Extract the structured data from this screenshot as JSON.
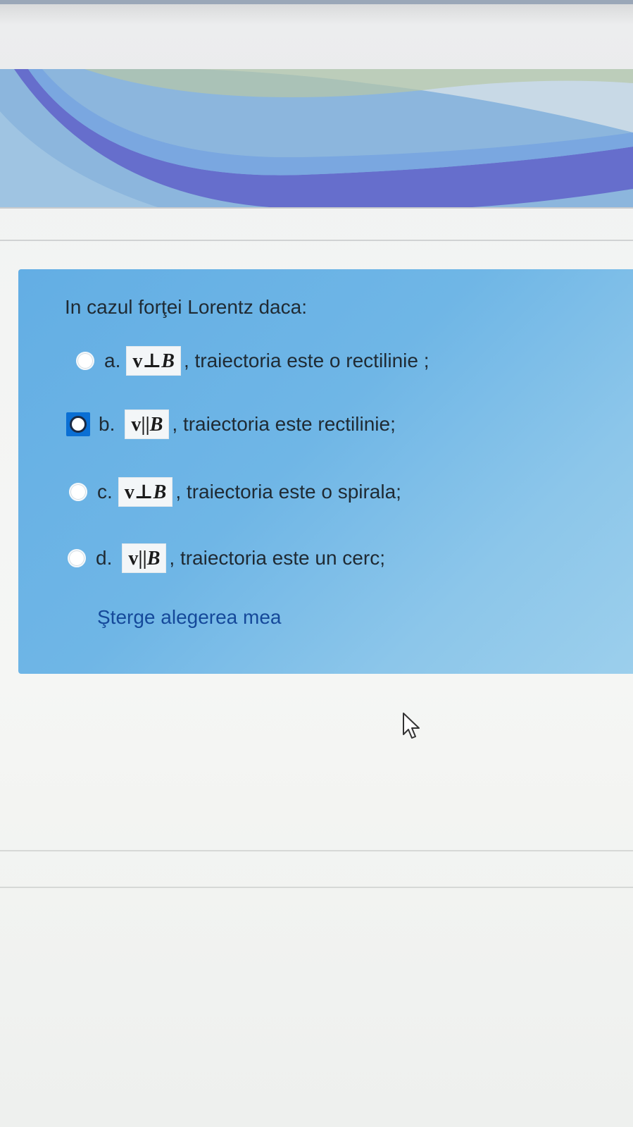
{
  "question": {
    "prompt": "In cazul forţei Lorentz daca:",
    "options": [
      {
        "letter": "a.",
        "math_v": "v",
        "math_rel": "⊥",
        "math_b": "B",
        "text": ", traiectoria este o rectilinie ;",
        "selected": false
      },
      {
        "letter": "b.",
        "math_v": "v",
        "math_rel": "||",
        "math_b": "B",
        "text": ", traiectoria este rectilinie;",
        "selected": true
      },
      {
        "letter": "c.",
        "math_v": "v",
        "math_rel": "⊥",
        "math_b": "B",
        "text": ", traiectoria este o spirala;",
        "selected": false
      },
      {
        "letter": "d.",
        "math_v": "v",
        "math_rel": "||",
        "math_b": "B",
        "text": ", traiectoria este un cerc;",
        "selected": false
      }
    ],
    "clear_label": "Şterge alegerea mea"
  },
  "colors": {
    "card": "#63aee4",
    "link": "#15499a",
    "focus": "#0a6fd4"
  },
  "icons": {
    "cursor": "mouse-pointer-icon"
  }
}
